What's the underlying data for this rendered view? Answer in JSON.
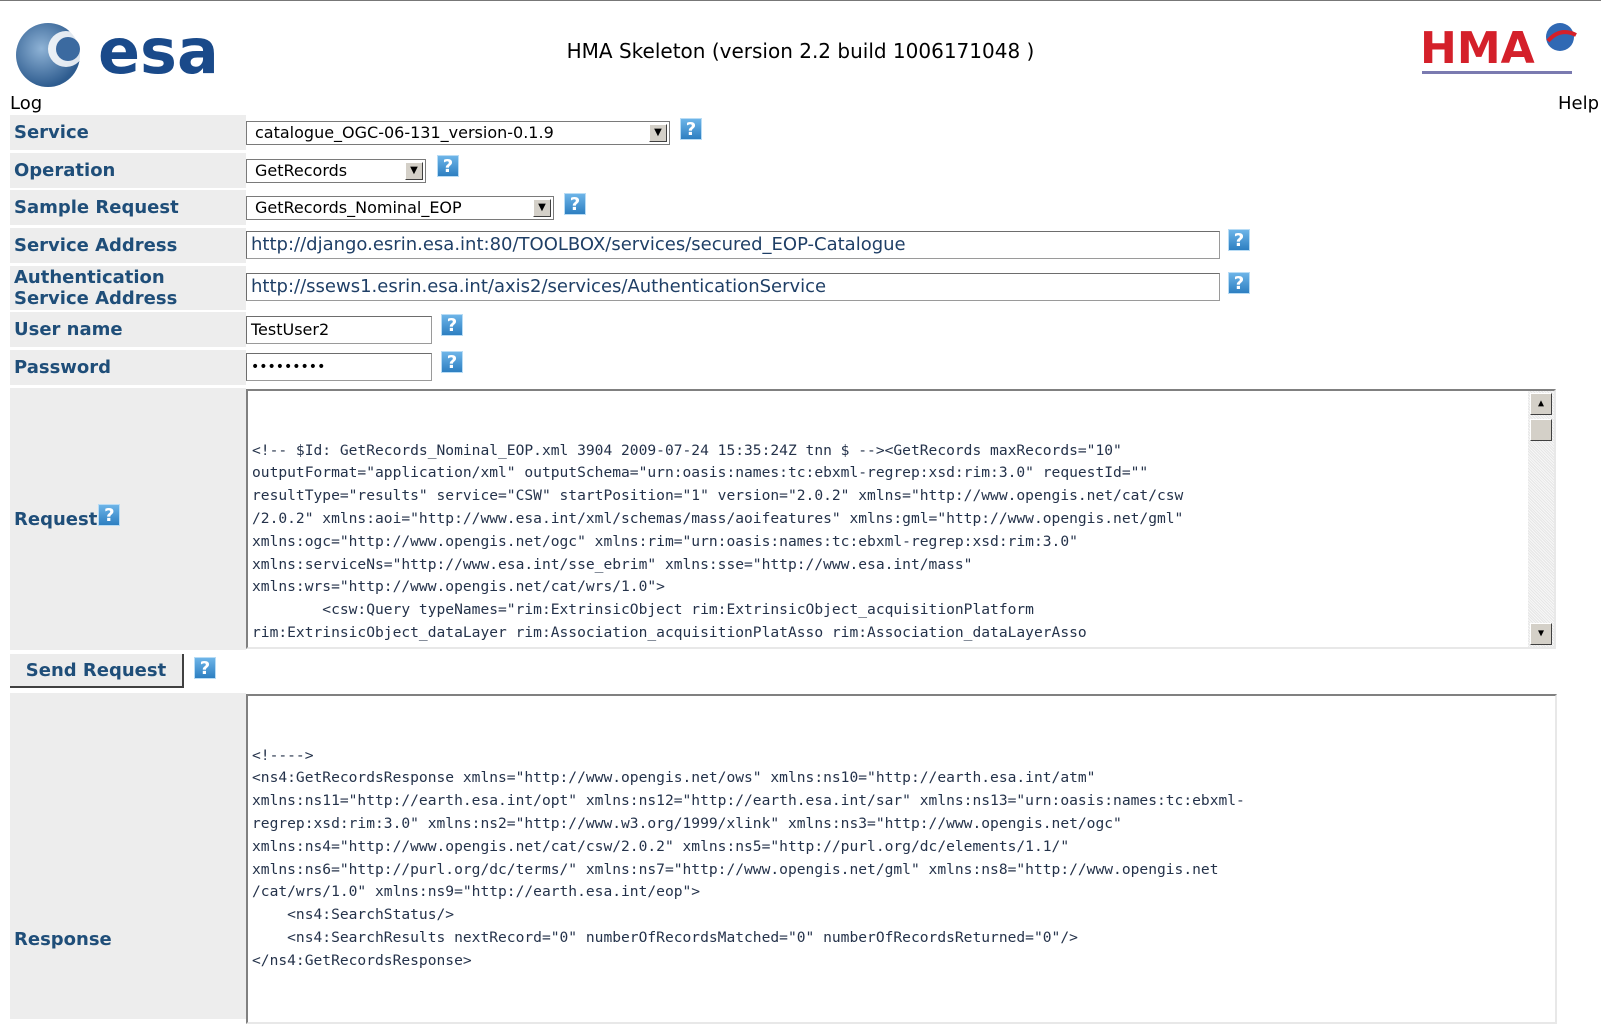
{
  "header": {
    "title": "HMA Skeleton (version 2.2 build 1006171048 )",
    "esa_logo_text": "esa",
    "hma_logo_text": "HMA",
    "log_link": "Log",
    "help_link": "Help"
  },
  "form": {
    "service": {
      "label": "Service",
      "value": "catalogue_OGC-06-131_version-0.1.9"
    },
    "operation": {
      "label": "Operation",
      "value": "GetRecords"
    },
    "sample_request": {
      "label": "Sample Request",
      "value": "GetRecords_Nominal_EOP"
    },
    "service_address": {
      "label": "Service Address",
      "value": "http://django.esrin.esa.int:80/TOOLBOX/services/secured_EOP-Catalogue"
    },
    "auth_address": {
      "label_line1": "Authentication",
      "label_line2": "Service Address",
      "value": "http://ssews1.esrin.esa.int/axis2/services/AuthenticationService"
    },
    "username": {
      "label": "User name",
      "value": "TestUser2"
    },
    "password": {
      "label": "Password",
      "value": "•••••••••"
    },
    "request": {
      "label": "Request",
      "text": "<!-- $Id: GetRecords_Nominal_EOP.xml 3904 2009-07-24 15:35:24Z tnn $ --><GetRecords maxRecords=\"10\"\noutputFormat=\"application/xml\" outputSchema=\"urn:oasis:names:tc:ebxml-regrep:xsd:rim:3.0\" requestId=\"\"\nresultType=\"results\" service=\"CSW\" startPosition=\"1\" version=\"2.0.2\" xmlns=\"http://www.opengis.net/cat/csw\n/2.0.2\" xmlns:aoi=\"http://www.esa.int/xml/schemas/mass/aoifeatures\" xmlns:gml=\"http://www.opengis.net/gml\"\nxmlns:ogc=\"http://www.opengis.net/ogc\" xmlns:rim=\"urn:oasis:names:tc:ebxml-regrep:xsd:rim:3.0\"\nxmlns:serviceNs=\"http://www.esa.int/sse_ebrim\" xmlns:sse=\"http://www.esa.int/mass\"\nxmlns:wrs=\"http://www.opengis.net/cat/wrs/1.0\">\n        <csw:Query typeNames=\"rim:ExtrinsicObject rim:ExtrinsicObject_acquisitionPlatform\nrim:ExtrinsicObject_dataLayer rim:Association_acquisitionPlatAsso rim:Association_dataLayerAsso\nrim:Classification rim:ClassificationNode\" xmlns:csw=\"http://www.opengis.net/cat/csw/2.0.2\">\n                <csw:ElementSetName typeNames=\"rim:ExtrinsicObject\">full</csw:ElementSetName>"
    },
    "send_button": "Send Request",
    "response": {
      "label": "Response",
      "text": "<!---->\n<ns4:GetRecordsResponse xmlns=\"http://www.opengis.net/ows\" xmlns:ns10=\"http://earth.esa.int/atm\"\nxmlns:ns11=\"http://earth.esa.int/opt\" xmlns:ns12=\"http://earth.esa.int/sar\" xmlns:ns13=\"urn:oasis:names:tc:ebxml-\nregrep:xsd:rim:3.0\" xmlns:ns2=\"http://www.w3.org/1999/xlink\" xmlns:ns3=\"http://www.opengis.net/ogc\"\nxmlns:ns4=\"http://www.opengis.net/cat/csw/2.0.2\" xmlns:ns5=\"http://purl.org/dc/elements/1.1/\"\nxmlns:ns6=\"http://purl.org/dc/terms/\" xmlns:ns7=\"http://www.opengis.net/gml\" xmlns:ns8=\"http://www.opengis.net\n/cat/wrs/1.0\" xmlns:ns9=\"http://earth.esa.int/eop\">\n    <ns4:SearchStatus/>\n    <ns4:SearchResults nextRecord=\"0\" numberOfRecordsMatched=\"0\" numberOfRecordsReturned=\"0\"/>\n</ns4:GetRecordsResponse>"
    },
    "help_icon": "?"
  }
}
